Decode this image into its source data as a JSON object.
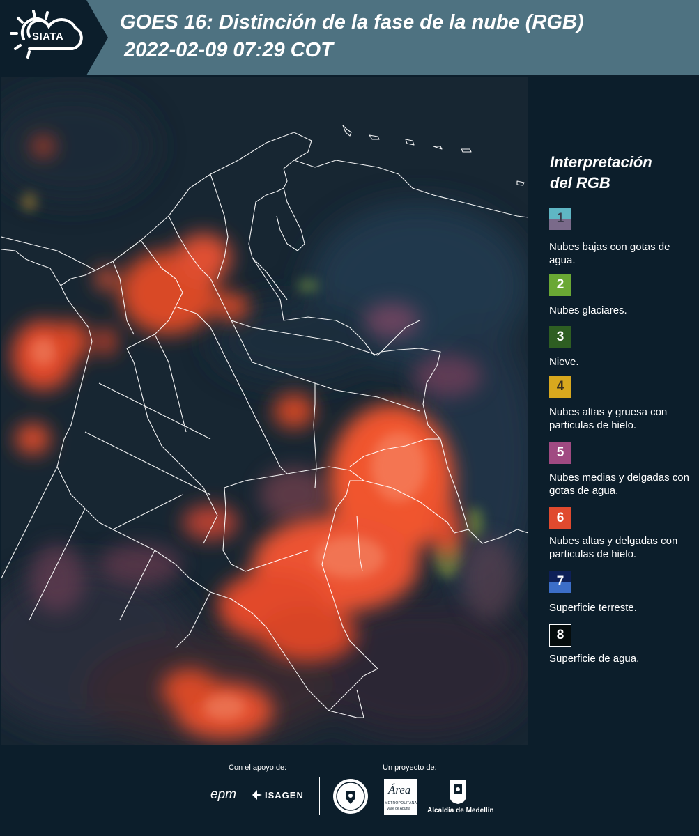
{
  "header": {
    "logo_text": "SIATA",
    "title": "GOES 16: Distinción de la fase de la nube (RGB)",
    "subtitle": "2022-02-09 07:29 COT"
  },
  "legend": {
    "title_line1": "Interpretación",
    "title_line2": "del RGB",
    "items": [
      {
        "number": "1",
        "label": "Nubes bajas con gotas de agua.",
        "color_top": "#5fb6c4",
        "color_bottom": "#7a6a8a",
        "text_color": "#3a3a4a"
      },
      {
        "number": "2",
        "label": "Nubes glaciares.",
        "color_top": "#6aa834",
        "color_bottom": "#6aa834",
        "text_color": "#ffffff"
      },
      {
        "number": "3",
        "label": "Nieve.",
        "color_top": "#2e5e22",
        "color_bottom": "#2e5e22",
        "text_color": "#ffffff"
      },
      {
        "number": "4",
        "label": "Nubes altas y gruesa con particulas de hielo.",
        "color_top": "#d8a81e",
        "color_bottom": "#d8a81e",
        "text_color": "#3a3020"
      },
      {
        "number": "5",
        "label": "Nubes medias y delgadas con gotas de agua.",
        "color_top": "#a04a82",
        "color_bottom": "#a04a82",
        "text_color": "#ffffff"
      },
      {
        "number": "6",
        "label": "Nubes altas y delgadas con particulas de hielo.",
        "color_top": "#e04a2e",
        "color_bottom": "#e04a2e",
        "text_color": "#ffffff"
      },
      {
        "number": "7",
        "label": "Superficie terreste.",
        "color_top": "#0e2058",
        "color_bottom": "#3c6ec8",
        "text_color": "#ffffff"
      },
      {
        "number": "8",
        "label": "Superficie de agua.",
        "color_top": "#050c0c",
        "color_bottom": "#050c0c",
        "text_color": "#ffffff"
      }
    ]
  },
  "footer": {
    "support_caption": "Con el apoyo de:",
    "project_caption": "Un proyecto de:",
    "epm": "epm",
    "isagen": "ISAGEN",
    "area_top": "Área",
    "area_mid": "METROPOLITANA",
    "area_bottom": "Valle de Aburrá",
    "alcaldia": "Alcaldía de Medellín"
  },
  "colors": {
    "header_bg": "#4e7281",
    "page_bg": "#0c1e2b",
    "cloud_orange": "#f0502a"
  }
}
